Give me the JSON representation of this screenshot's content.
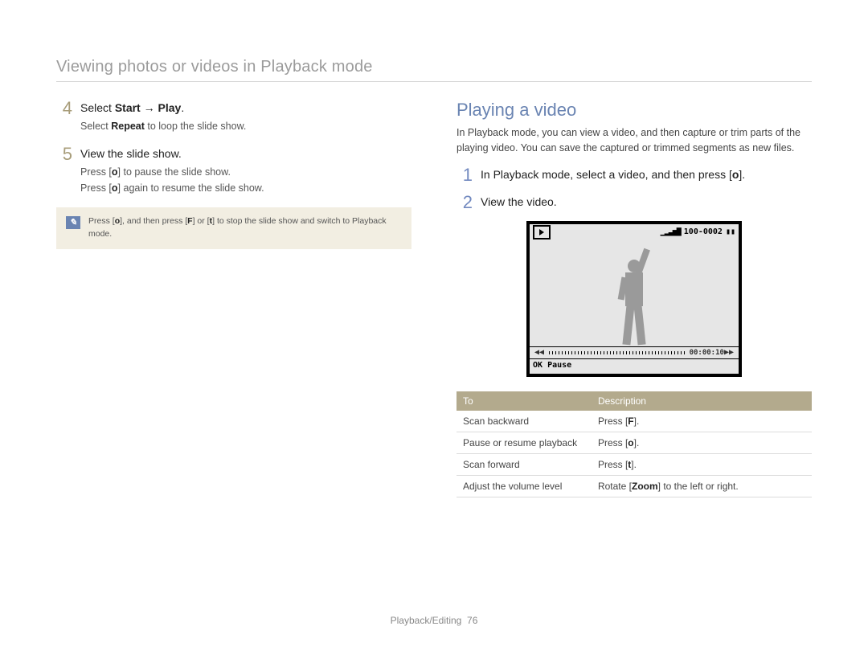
{
  "header": "Viewing photos or videos in Playback mode",
  "left": {
    "step4": {
      "num": "4",
      "title_a": "Select ",
      "title_b": "Start",
      "title_c": " → ",
      "title_d": "Play",
      "title_e": ".",
      "sub_a": "Select ",
      "sub_b": "Repeat",
      "sub_c": " to loop the slide show."
    },
    "step5": {
      "num": "5",
      "title": "View the slide show.",
      "line1_a": "Press [",
      "line1_b": "o",
      "line1_c": "] to pause the slide show.",
      "line2_a": "Press [",
      "line2_b": "o",
      "line2_c": "] again to resume the slide show."
    },
    "note": {
      "a": "Press [",
      "b": "o",
      "c": "], and then press [",
      "d": "F",
      "e": "] or [",
      "f": "t",
      "g": "] to stop the slide show and switch to Playback mode."
    }
  },
  "right": {
    "heading": "Playing a video",
    "desc": "In Playback mode, you can view a video, and then capture or trim parts of the playing video. You can save the captured or trimmed segments as new files.",
    "step1": {
      "num": "1",
      "a": "In Playback mode, select a video, and then press [",
      "b": "o",
      "c": "]."
    },
    "step2": {
      "num": "2",
      "title": "View the video."
    },
    "lcd": {
      "counter": "100-0002",
      "battery": "▮▮",
      "time": "00:00:10",
      "ok": "OK",
      "pause": "Pause"
    },
    "table": {
      "head_to": "To",
      "head_desc": "Description",
      "rows": [
        {
          "to": "Scan backward",
          "a": "Press [",
          "b": "F",
          "c": "]."
        },
        {
          "to": "Pause or resume playback",
          "a": "Press [",
          "b": "o",
          "c": "]."
        },
        {
          "to": "Scan forward",
          "a": "Press [",
          "b": "t",
          "c": "]."
        },
        {
          "to": "Adjust the volume level",
          "a": "Rotate [",
          "b": "Zoom",
          "c": "] to the left or right."
        }
      ]
    }
  },
  "footer": {
    "section": "Playback/Editing",
    "page": "76"
  }
}
